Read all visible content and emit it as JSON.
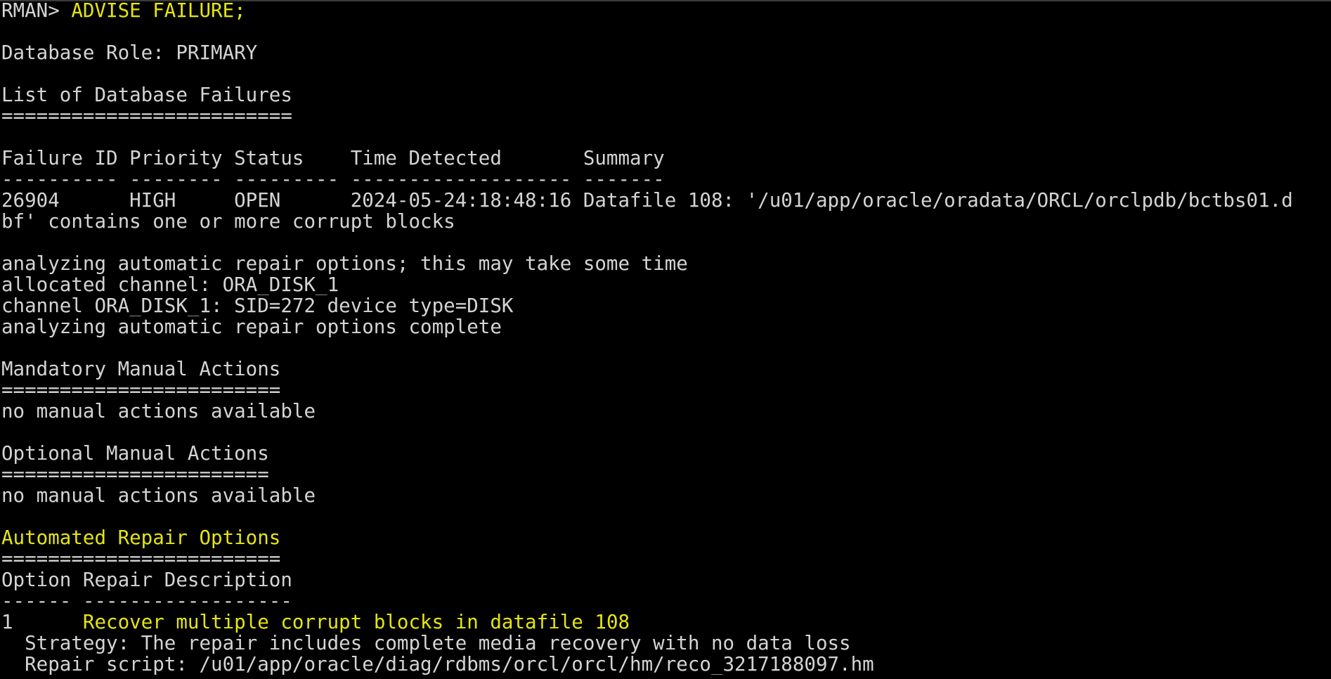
{
  "colors": {
    "background": "#000000",
    "text": "#d4d4d4",
    "highlight": "#e5e510"
  },
  "terminal": {
    "prompt": "RMAN> ",
    "command": "ADVISE FAILURE;",
    "database_role": "Database Role: PRIMARY",
    "failures_heading": "List of Database Failures",
    "failures_rule": "=========================",
    "failures_table": {
      "header": "Failure ID Priority Status    Time Detected       Summary",
      "separator": "---------- -------- --------- ------------------- -------",
      "row_line1": "26904      HIGH     OPEN      2024-05-24:18:48:16 Datafile 108: '/u01/app/oracle/oradata/ORCL/orclpdb/bctbs01.d",
      "row_line2": "bf' contains one or more corrupt blocks"
    },
    "analysis": [
      "analyzing automatic repair options; this may take some time",
      "allocated channel: ORA_DISK_1",
      "channel ORA_DISK_1: SID=272 device type=DISK",
      "analyzing automatic repair options complete"
    ],
    "mandatory": {
      "heading": "Mandatory Manual Actions",
      "rule": "========================",
      "text": "no manual actions available"
    },
    "optional": {
      "heading": "Optional Manual Actions",
      "rule": "=======================",
      "text": "no manual actions available"
    },
    "automated": {
      "heading": "Automated Repair Options",
      "rule": "========================",
      "table_header": "Option Repair Description",
      "table_separator": "------ ------------------",
      "option_number": "1      ",
      "option_description": "Recover multiple corrupt blocks in datafile 108",
      "strategy": "  Strategy: The repair includes complete media recovery with no data loss",
      "repair_script": "  Repair script: /u01/app/oracle/diag/rdbms/orcl/orcl/hm/reco_3217188097.hm"
    }
  }
}
